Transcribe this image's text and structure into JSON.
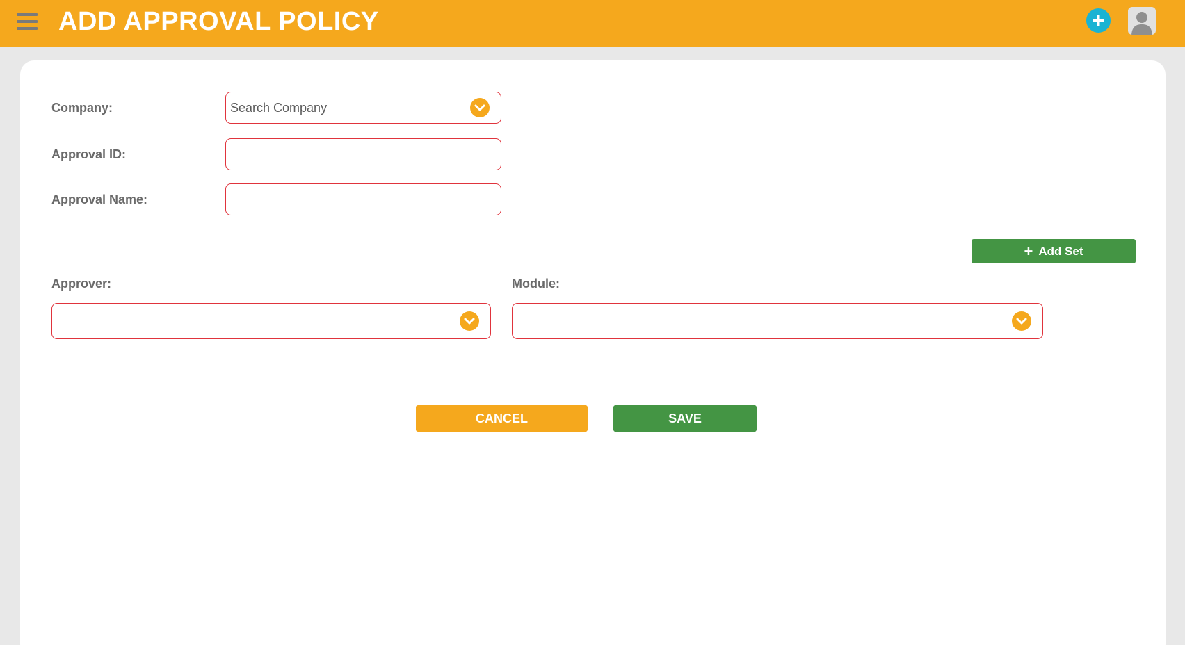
{
  "header": {
    "title": "ADD APPROVAL POLICY",
    "menu_icon": "hamburger-menu-icon",
    "add_icon": "plus-circle-icon",
    "avatar_icon": "user-avatar-icon",
    "colors": {
      "brand": "#f5a81d",
      "add_accent": "#19b3d3"
    }
  },
  "form": {
    "company": {
      "label": "Company:",
      "placeholder": "Search Company",
      "value": ""
    },
    "approval_id": {
      "label": "Approval ID:",
      "value": ""
    },
    "approval_name": {
      "label": "Approval Name:",
      "value": ""
    },
    "add_set": {
      "label": "Add Set",
      "icon": "plus-icon"
    },
    "approver": {
      "label": "Approver:",
      "value": ""
    },
    "module": {
      "label": "Module:",
      "value": ""
    },
    "field_border_color": "#e0343d"
  },
  "actions": {
    "cancel_label": "CANCEL",
    "save_label": "SAVE",
    "colors": {
      "cancel": "#f5a81d",
      "save": "#449544"
    }
  }
}
